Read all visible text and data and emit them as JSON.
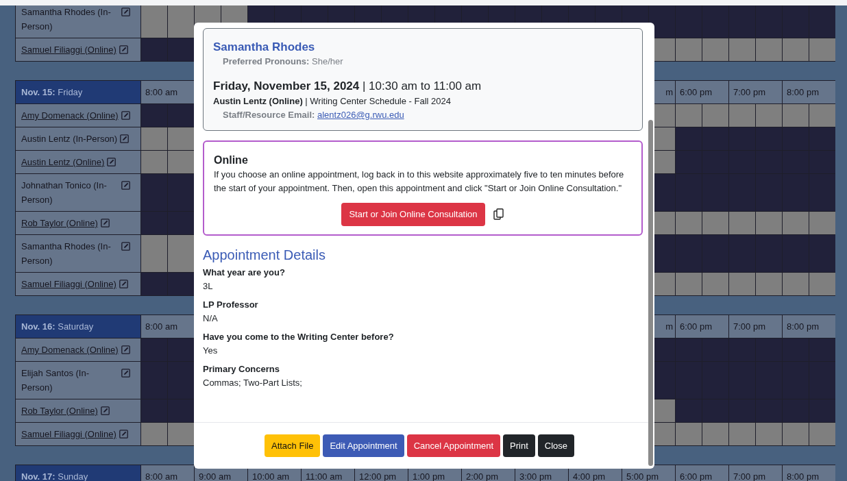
{
  "schedule": [
    {
      "rows": [
        {
          "name": "Samantha Rhodes (In-Person)",
          "linked": false,
          "slots_left": [
            true,
            true,
            true,
            true,
            false,
            false,
            false,
            false,
            false,
            false,
            false,
            false,
            false,
            false,
            false,
            false,
            false,
            false,
            false
          ],
          "slots_right": [
            false,
            false,
            false,
            false,
            false,
            false,
            false
          ]
        },
        {
          "name": "Samuel Filiaggi (Online)",
          "linked": true,
          "slots_left": [
            false,
            false
          ],
          "slots_right": [
            true,
            true,
            true,
            true,
            true,
            true,
            true
          ]
        }
      ]
    },
    {
      "date": "**Nov. 15:** Friday",
      "hours_left": [
        "8:00 am"
      ],
      "hours_right": [
        "m",
        "6:00 pm",
        "7:00 pm",
        "8:00 pm"
      ],
      "rows": [
        {
          "name": "Amy Domenack (Online)",
          "linked": true,
          "slots_left": [
            false,
            false
          ],
          "slots_right": [
            true,
            true,
            true,
            true,
            true,
            true,
            true
          ]
        },
        {
          "name": "Austin Lentz (In-Person)",
          "linked": false,
          "slots_left": [
            true,
            true
          ],
          "slots_right": [
            true,
            false,
            false,
            false,
            false,
            false,
            false
          ]
        },
        {
          "name": "Austin Lentz (Online)",
          "linked": true,
          "slots_left": [
            true,
            true
          ],
          "slots_right": [
            true,
            false,
            false,
            false,
            false,
            false,
            false
          ]
        },
        {
          "name": "Johnathan Tonico (In-Person)",
          "linked": false,
          "slots_left": [
            false,
            false
          ],
          "slots_right": [
            false,
            false,
            false,
            false,
            false,
            false,
            false
          ]
        },
        {
          "name": "Rob Taylor (Online)",
          "linked": true,
          "slots_left": [
            false,
            false
          ],
          "slots_right": [
            true,
            true,
            true,
            true,
            true,
            true,
            true
          ]
        },
        {
          "name": "Samantha Rhodes (In-Person)",
          "linked": false,
          "slots_left": [
            true,
            true
          ],
          "slots_right": [
            false,
            false,
            false,
            false,
            false,
            false,
            false
          ]
        },
        {
          "name": "Samuel Filiaggi (Online)",
          "linked": true,
          "slots_left": [
            false,
            false
          ],
          "slots_right": [
            true,
            true,
            true,
            true,
            true,
            true,
            true
          ]
        }
      ]
    },
    {
      "date": "**Nov. 16:** Saturday",
      "hours_left": [
        "8:00 am"
      ],
      "hours_right": [
        "m",
        "6:00 pm",
        "7:00 pm",
        "8:00 pm"
      ],
      "rows": [
        {
          "name": "Amy Domenack (Online)",
          "linked": true,
          "slots_left": [
            false,
            false
          ],
          "slots_right": [
            false,
            false,
            false,
            false,
            false,
            false,
            false
          ]
        },
        {
          "name": "Elijah Santos (In-Person)",
          "linked": false,
          "slots_left": [
            false,
            false
          ],
          "slots_right": [
            false,
            false,
            false,
            false,
            false,
            false,
            false
          ]
        },
        {
          "name": "Rob Taylor (Online)",
          "linked": true,
          "slots_left": [
            false,
            false
          ],
          "slots_right": [
            true,
            false,
            false,
            false,
            false,
            false,
            false
          ]
        },
        {
          "name": "Samuel Filiaggi (Online)",
          "linked": true,
          "slots_left": [
            true,
            true
          ],
          "slots_right": [
            true,
            true,
            true,
            true,
            true,
            true,
            true
          ]
        }
      ]
    },
    {
      "date": "**Nov. 17:** Sunday",
      "hours_left": [
        "8:00 am",
        "9:00 am",
        "10:00 am",
        "11:00 am",
        "12:00 pm",
        "1:00 pm",
        "2:00 pm",
        "3:00 pm",
        "4:00 pm",
        "5:00 pm",
        "6:00 pm",
        "7:00 pm",
        "8:00 pm"
      ]
    }
  ],
  "modal": {
    "student": "Samantha Rhodes",
    "pronouns": "**Preferred Pronouns:** She/her",
    "when": "**Friday, November 15, 2024** | 10:30 am to 11:00 am",
    "staff": "**Austin Lentz (Online)** | Writing Center Schedule - Fall 2024",
    "email_label": "Staff/Resource Email:",
    "email": "alentz026@g.rwu.edu",
    "online": {
      "title": "Online",
      "text": "If you choose an online appointment, log back in to this website approximately five to ten minutes before the start of your appointment. Then, open this appointment and click \"Start or Join Online Consultation.\"",
      "button": "Start or Join Online Consultation"
    },
    "details_title": "Appointment Details",
    "details": [
      {
        "question": "What year are you?",
        "answer": "3L"
      },
      {
        "question": "LP Professor",
        "answer": "N/A"
      },
      {
        "question": "Have you come to the Writing Center before?",
        "answer": "Yes"
      },
      {
        "question": "Primary Concerns",
        "answer": "Commas; Two-Part Lists;"
      }
    ],
    "buttons": [
      {
        "label": "Attach File",
        "kind": "warning"
      },
      {
        "label": "Edit Appointment",
        "kind": "primary"
      },
      {
        "label": "Cancel Appointment",
        "kind": "danger"
      },
      {
        "label": "Print",
        "kind": "dark"
      },
      {
        "label": "Close",
        "kind": "dark"
      }
    ]
  }
}
